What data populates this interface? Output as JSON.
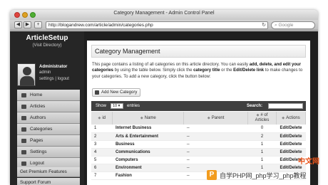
{
  "window": {
    "title": "Category Management - Admin Control Panel",
    "url": "http://blogandrew.com/article/admin/categories.php",
    "search_placeholder": "Google",
    "back": "◀",
    "forward": "▶",
    "add": "+"
  },
  "sidebar": {
    "brand": "ArticleSetup",
    "brand_sub": "(Visit Directory)",
    "profile": {
      "name": "Administrator",
      "role": "admin",
      "links": "settings | logout"
    },
    "nav": [
      {
        "label": "Home",
        "icon": "home-icon"
      },
      {
        "label": "Articles",
        "icon": "articles-icon"
      },
      {
        "label": "Authors",
        "icon": "authors-icon"
      },
      {
        "label": "Categories",
        "icon": "categories-icon"
      },
      {
        "label": "Pages",
        "icon": "pages-icon"
      },
      {
        "label": "Settings",
        "icon": "gear-icon"
      },
      {
        "label": "Logout",
        "icon": "logout-icon"
      }
    ],
    "extra1": "Get Premium Features",
    "extra2": "Support Forum"
  },
  "main": {
    "heading": "Category Management",
    "desc_1": "This page contains a listing of all categories on this article directory. You can easily ",
    "desc_b1": "add, delete, and edit your categories",
    "desc_2": " by using the table below. Simply click the ",
    "desc_b2": "category title",
    "desc_3": " or the ",
    "desc_b3": "Edit/Delete link",
    "desc_4": " to make changes to your categories. To add a new category, click the button below:",
    "add_button": "Add New Category",
    "show_label": "Show",
    "show_value": "10",
    "entries_label": "entries",
    "search_label": "Search:",
    "columns": [
      "id",
      "Name",
      "Parent",
      "# of Articles",
      "Actions"
    ],
    "rows": [
      [
        "1",
        "Internet Business",
        "--",
        "0",
        "Edit/Delete"
      ],
      [
        "2",
        "Arts & Entertainment",
        "--",
        "2",
        "Edit/Delete"
      ],
      [
        "3",
        "Business",
        "--",
        "1",
        "Edit/Delete"
      ],
      [
        "4",
        "Communications",
        "--",
        "1",
        "Edit/Delete"
      ],
      [
        "5",
        "Computers",
        "--",
        "1",
        "Edit/Delete"
      ],
      [
        "6",
        "Environment",
        "--",
        "1",
        "Edit/Delete"
      ],
      [
        "7",
        "Fashion",
        "--",
        "",
        ""
      ]
    ]
  },
  "watermark": {
    "logo": "P",
    "text": "自学PHP网_php学习_php教程",
    "corner": "中文网"
  }
}
